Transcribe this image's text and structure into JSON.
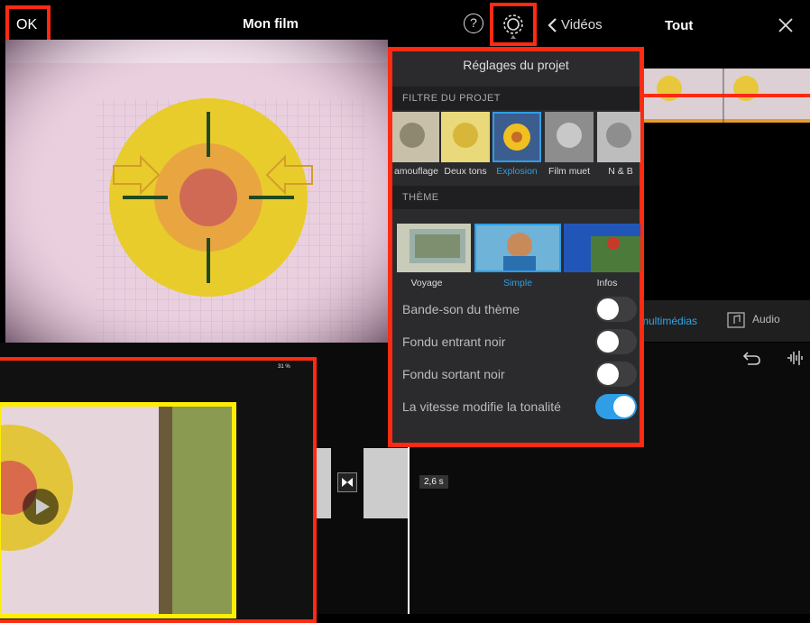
{
  "toolbar": {
    "ok_label": "OK",
    "title": "Mon film",
    "help_label": "?",
    "back_label": "Vidéos",
    "right_title": "Tout"
  },
  "media_tabs": {
    "multimedia_label": "multimédias",
    "audio_label": "Audio"
  },
  "timeline": {
    "duration_label": "2,6 s",
    "inset_battery": "31 %"
  },
  "settings": {
    "title": "Réglages du projet",
    "filter_section": "FILTRE DU PROJET",
    "filters": [
      {
        "label": "amouflage",
        "selected": false
      },
      {
        "label": "Deux tons",
        "selected": false
      },
      {
        "label": "Explosion",
        "selected": true
      },
      {
        "label": "Film muet",
        "selected": false
      },
      {
        "label": "N & B",
        "selected": false
      }
    ],
    "theme_section": "THÈME",
    "themes": [
      {
        "label": "Voyage",
        "selected": false
      },
      {
        "label": "Simple",
        "selected": true
      },
      {
        "label": "Infos",
        "selected": false
      }
    ],
    "toggles": [
      {
        "label": "Bande-son du thème",
        "on": false
      },
      {
        "label": "Fondu entrant noir",
        "on": false
      },
      {
        "label": "Fondu sortant noir",
        "on": false
      },
      {
        "label": "La vitesse modifie la tonalité",
        "on": true
      }
    ]
  },
  "colors": {
    "highlight_red": "#ff2a12",
    "highlight_yellow": "#ffee00",
    "accent_blue": "#2f9ee6"
  }
}
